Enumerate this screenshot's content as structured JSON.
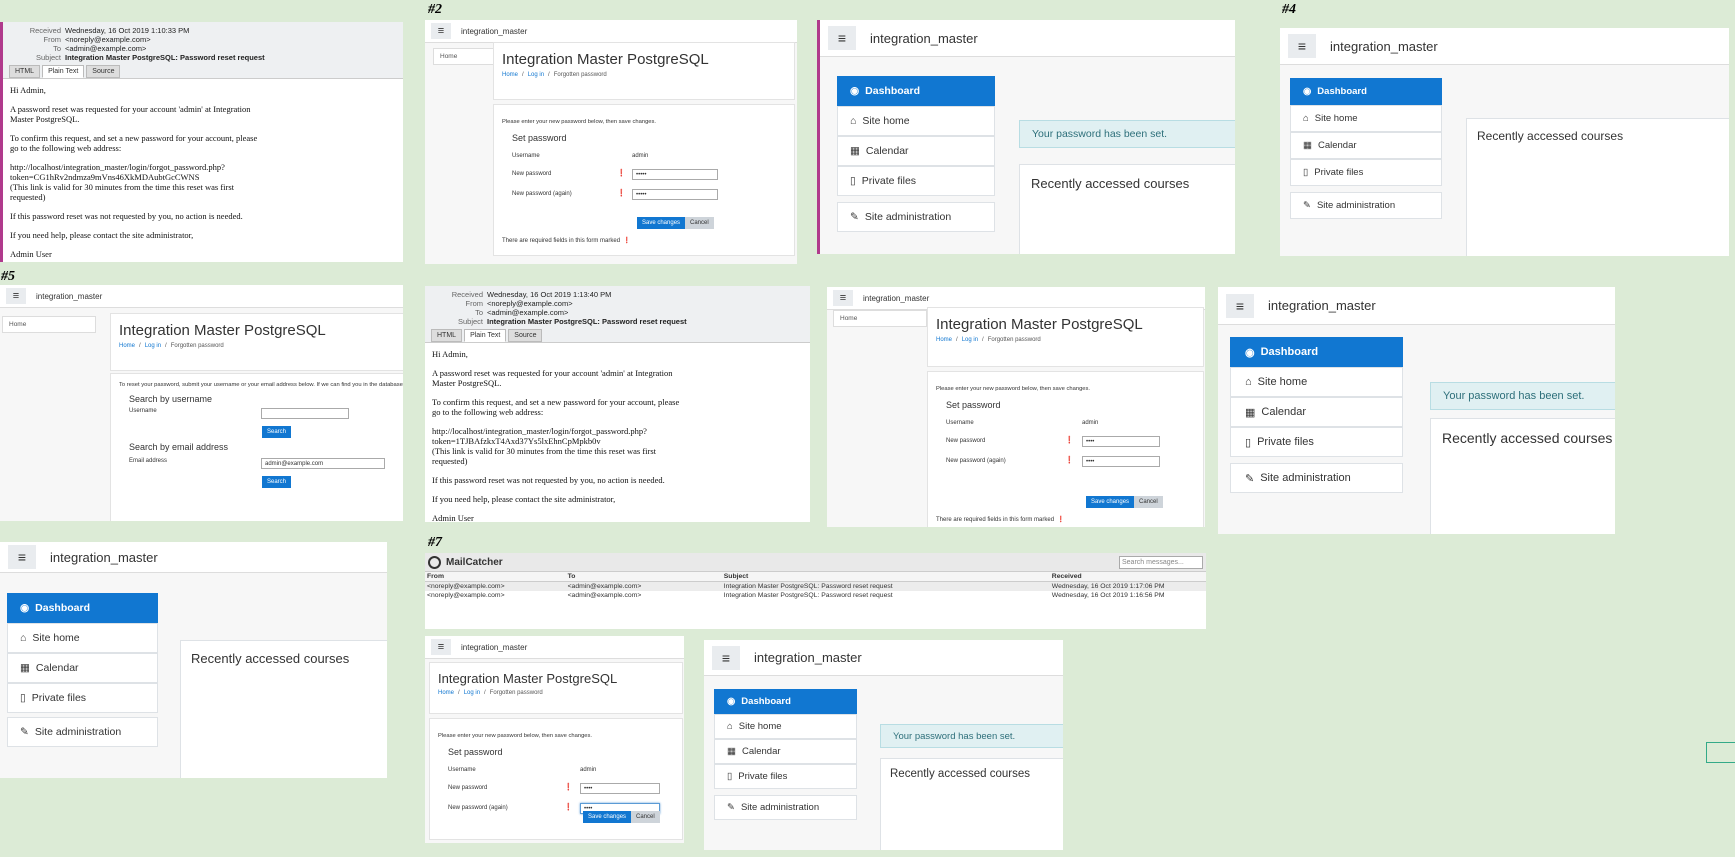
{
  "labels": {
    "n2": "#2",
    "n4": "#4",
    "n5": "#5",
    "n7": "#7"
  },
  "email1": {
    "meta": [
      {
        "k": "Received",
        "v": "Wednesday, 16 Oct 2019 1:10:33 PM"
      },
      {
        "k": "From",
        "v": "<noreply@example.com>"
      },
      {
        "k": "To",
        "v": "<admin@example.com>"
      },
      {
        "k": "Subject",
        "v": "Integration Master PostgreSQL: Password reset request"
      }
    ],
    "tabs": [
      "HTML",
      "Plain Text",
      "Source"
    ],
    "body": [
      "Hi Admin,",
      "A password reset was requested for your account 'admin' at Integration\nMaster PostgreSQL.",
      "To confirm this request, and set a new password for your account, please\ngo to the following web address:",
      "http://localhost/integration_master/login/forgot_password.php?token=CG1hRv2ndmza9mVns46XkMDAubtGcCWNS\n(This link is valid for 30 minutes from the time this reset was first\nrequested)",
      "If this password reset was not requested by you, no action is needed.",
      "If you need help, please contact the site administrator,",
      "Admin User"
    ]
  },
  "email2": {
    "meta": [
      {
        "k": "Received",
        "v": "Wednesday, 16 Oct 2019 1:13:40 PM"
      },
      {
        "k": "From",
        "v": "<noreply@example.com>"
      },
      {
        "k": "To",
        "v": "<admin@example.com>"
      },
      {
        "k": "Subject",
        "v": "Integration Master PostgreSQL: Password reset request"
      }
    ],
    "tabs": [
      "HTML",
      "Plain Text",
      "Source"
    ],
    "body": [
      "Hi Admin,",
      "A password reset was requested for your account 'admin' at Integration\nMaster PostgreSQL.",
      "To confirm this request, and set a new password for your account, please\ngo to the following web address:",
      "http://localhost/integration_master/login/forgot_password.php?token=1TJBAfzkxT4Axd37Ys5lxEhnCpMpkb0v\n(This link is valid for 30 minutes from the time this reset was first\nrequested)",
      "If this password reset was not requested by you, no action is needed.",
      "If you need help, please contact the site administrator,",
      "Admin User"
    ]
  },
  "site": {
    "brand": "integration_master",
    "home": "Home",
    "title": "Integration Master PostgreSQL",
    "crumb_home": "Home",
    "crumb_login": "Log in",
    "crumb_current": "Forgotten password",
    "sep": "/"
  },
  "setpw": {
    "instr": "Please enter your new password below, then save changes.",
    "legend": "Set password",
    "username_label": "Username",
    "username_value": "admin",
    "newpw_label": "New password",
    "newpw2_label": "New password (again)",
    "pw_mask5": "•••••",
    "pw_mask4": "••••",
    "save": "Save changes",
    "cancel": "Cancel",
    "required_note": "There are required fields in this form marked",
    "req_icon": "❗"
  },
  "search": {
    "instr": "To reset your password, submit your username or your email address below. If we can find you in the database",
    "by_username": "Search by username",
    "username_label": "Username",
    "search_btn": "Search",
    "by_email": "Search by email address",
    "email_label": "Email address",
    "email_value": "admin@example.com"
  },
  "dashboard": {
    "items": [
      {
        "icon": "dashboard-icon",
        "glyph": "◉",
        "label": "Dashboard",
        "active": true
      },
      {
        "icon": "home-icon",
        "glyph": "⌂",
        "label": "Site home"
      },
      {
        "icon": "calendar-icon",
        "glyph": "▦",
        "label": "Calendar"
      },
      {
        "icon": "file-icon",
        "glyph": "▯",
        "label": "Private files"
      },
      {
        "icon": "wrench-icon",
        "glyph": "✎",
        "label": "Site administration"
      }
    ],
    "alert": "Your password has been set.",
    "courses": "Recently accessed courses"
  },
  "mailcatcher": {
    "title": "MailCatcher",
    "search_placeholder": "Search messages...",
    "columns": [
      "From",
      "To",
      "Subject",
      "Received"
    ],
    "rows": [
      {
        "from": "<noreply@example.com>",
        "to": "<admin@example.com>",
        "subject": "Integration Master PostgreSQL: Password reset request",
        "received": "Wednesday, 16 Oct 2019 1:17:06 PM"
      },
      {
        "from": "<noreply@example.com>",
        "to": "<admin@example.com>",
        "subject": "Integration Master PostgreSQL: Password reset request",
        "received": "Wednesday, 16 Oct 2019 1:16:56 PM"
      }
    ]
  },
  "colors": {
    "primary": "#1177d1",
    "background": "#dcebd6",
    "accent": "#b03a8c"
  }
}
